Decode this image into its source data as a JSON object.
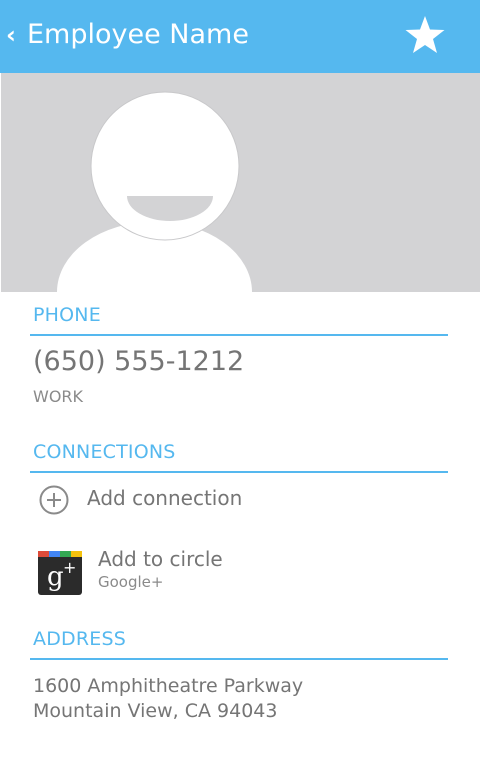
{
  "header": {
    "title": "Employee Name",
    "back_icon": "chevron-left-icon",
    "star_icon": "star-icon"
  },
  "photo": {
    "icon": "default-contact-avatar-icon"
  },
  "phone_section": {
    "title": "PHONE",
    "number": "(650) 555-1212",
    "type": "WORK"
  },
  "connections_section": {
    "title": "CONNECTIONS",
    "add_connection": {
      "label": "Add connection",
      "icon": "plus-circle-icon"
    },
    "add_to_circle": {
      "label": "Add to circle",
      "sublabel": "Google+",
      "icon": "google-plus-icon"
    }
  },
  "address_section": {
    "title": "ADDRESS",
    "line1": "1600 Amphitheatre Parkway",
    "line2": "Mountain View, CA 94043"
  },
  "colors": {
    "accent": "#55b8ef",
    "photo_background": "#d3d3d5",
    "secondary_text": "#757575"
  }
}
